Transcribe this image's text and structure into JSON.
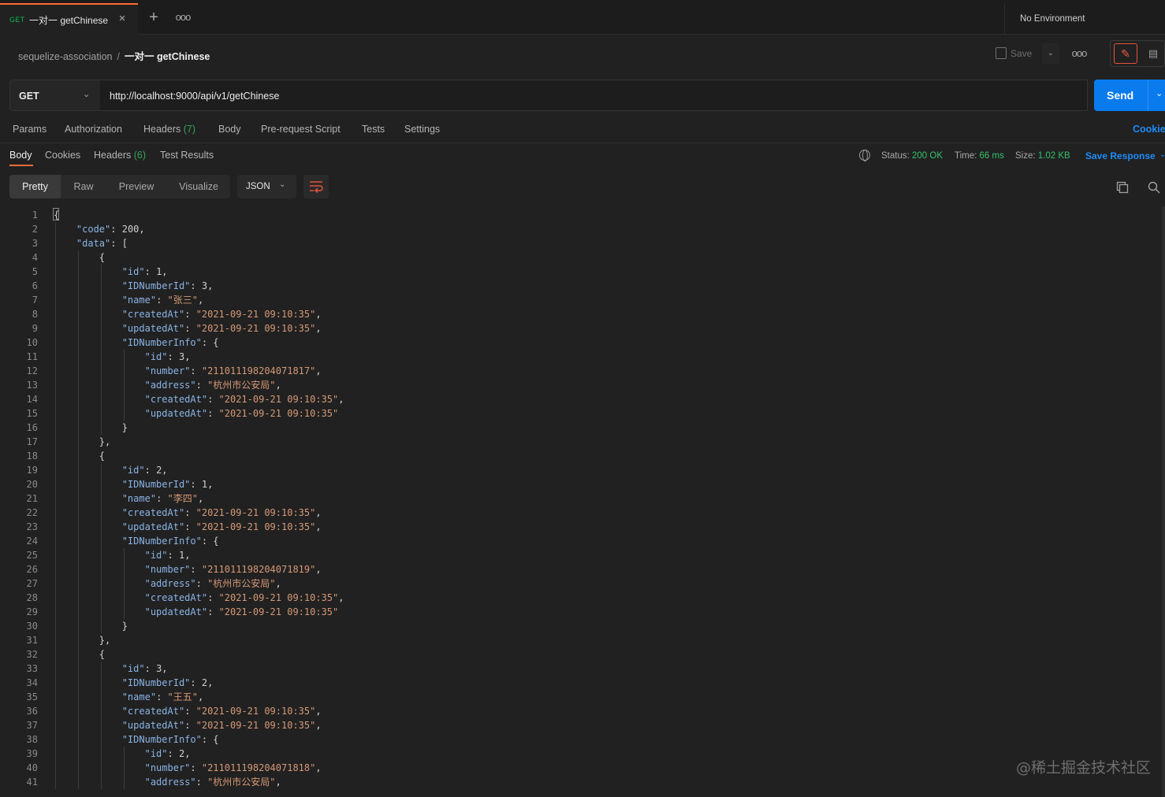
{
  "tab": {
    "method": "GET",
    "title": "一对一 getChinese",
    "close": "×",
    "add": "+",
    "more": "ooo"
  },
  "environment": "No Environment",
  "breadcrumb": {
    "collection": "sequelize-association",
    "separator": "/",
    "request": "一对一 getChinese"
  },
  "actions": {
    "save_label": "Save",
    "more": "ooo"
  },
  "request": {
    "method": "GET",
    "url": "http://localhost:9000/api/v1/getChinese",
    "send_label": "Send"
  },
  "request_tabs": [
    {
      "label": "Params",
      "count": ""
    },
    {
      "label": "Authorization",
      "count": ""
    },
    {
      "label": "Headers",
      "count": "(7)"
    },
    {
      "label": "Body",
      "count": ""
    },
    {
      "label": "Pre-request Script",
      "count": ""
    },
    {
      "label": "Tests",
      "count": ""
    },
    {
      "label": "Settings",
      "count": ""
    }
  ],
  "cookies_link": "Cookie",
  "response_tabs": [
    {
      "label": "Body",
      "count": ""
    },
    {
      "label": "Cookies",
      "count": ""
    },
    {
      "label": "Headers",
      "count": "(6)"
    },
    {
      "label": "Test Results",
      "count": ""
    }
  ],
  "response_meta": {
    "status_label": "Status:",
    "status_value": "200 OK",
    "time_label": "Time:",
    "time_value": "66 ms",
    "size_label": "Size:",
    "size_value": "1.02 KB",
    "save_response": "Save Response"
  },
  "view_modes": [
    "Pretty",
    "Raw",
    "Preview",
    "Visualize"
  ],
  "format": "JSON",
  "colors": {
    "accent": "#ff6c37",
    "send": "#097bed",
    "status_ok": "#35c26a",
    "json_key": "#8ab4e6",
    "json_string": "#d69977"
  },
  "code_lines": [
    "{",
    "    \"code\": 200,",
    "    \"data\": [",
    "        {",
    "            \"id\": 1,",
    "            \"IDNumberId\": 3,",
    "            \"name\": \"张三\",",
    "            \"createdAt\": \"2021-09-21 09:10:35\",",
    "            \"updatedAt\": \"2021-09-21 09:10:35\",",
    "            \"IDNumberInfo\": {",
    "                \"id\": 3,",
    "                \"number\": \"211011198204071817\",",
    "                \"address\": \"杭州市公安局\",",
    "                \"createdAt\": \"2021-09-21 09:10:35\",",
    "                \"updatedAt\": \"2021-09-21 09:10:35\"",
    "            }",
    "        },",
    "        {",
    "            \"id\": 2,",
    "            \"IDNumberId\": 1,",
    "            \"name\": \"李四\",",
    "            \"createdAt\": \"2021-09-21 09:10:35\",",
    "            \"updatedAt\": \"2021-09-21 09:10:35\",",
    "            \"IDNumberInfo\": {",
    "                \"id\": 1,",
    "                \"number\": \"211011198204071819\",",
    "                \"address\": \"杭州市公安局\",",
    "                \"createdAt\": \"2021-09-21 09:10:35\",",
    "                \"updatedAt\": \"2021-09-21 09:10:35\"",
    "            }",
    "        },",
    "        {",
    "            \"id\": 3,",
    "            \"IDNumberId\": 2,",
    "            \"name\": \"王五\",",
    "            \"createdAt\": \"2021-09-21 09:10:35\",",
    "            \"updatedAt\": \"2021-09-21 09:10:35\",",
    "            \"IDNumberInfo\": {",
    "                \"id\": 2,",
    "                \"number\": \"211011198204071818\",",
    "                \"address\": \"杭州市公安局\","
  ],
  "watermark": "@稀土掘金技术社区"
}
